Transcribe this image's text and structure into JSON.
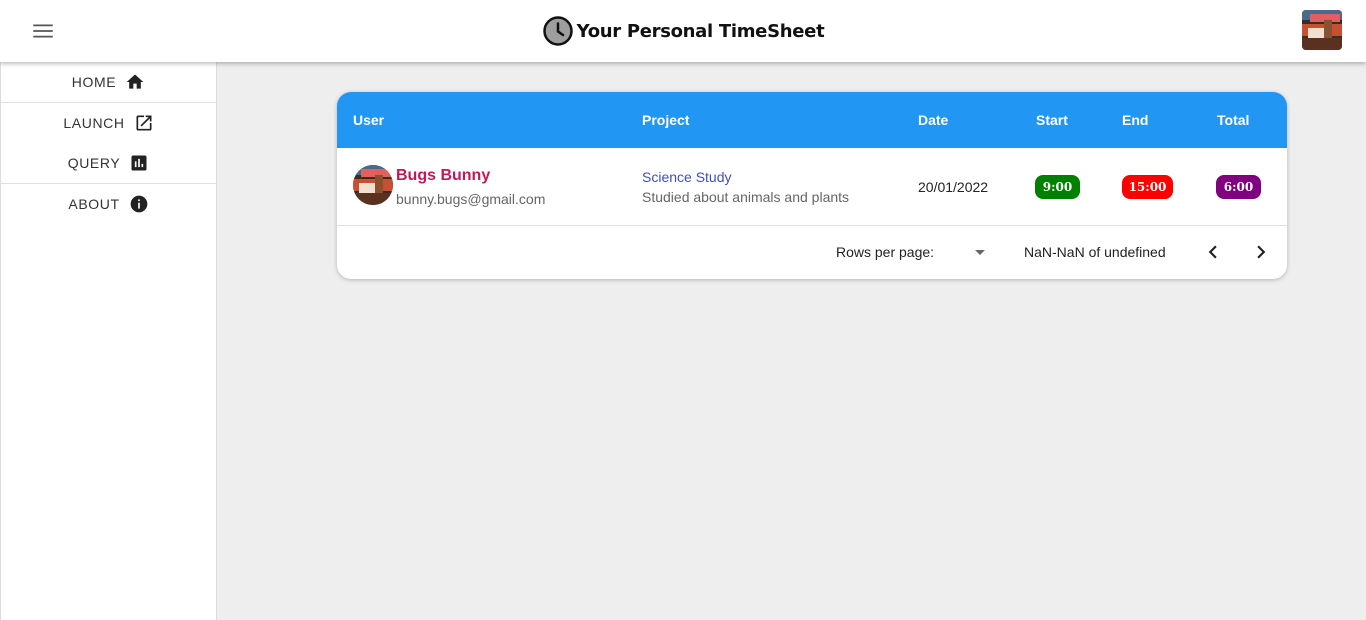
{
  "app": {
    "title": "Your Personal TimeSheet",
    "icons": {
      "menu": "menu-icon",
      "clock": "clock-icon",
      "profile": "profile-avatar"
    }
  },
  "sidebar": {
    "items": [
      {
        "label": "HOME",
        "icon": "home-icon"
      },
      {
        "label": "LAUNCH",
        "icon": "launch-icon"
      },
      {
        "label": "QUERY",
        "icon": "chart-icon"
      },
      {
        "label": "ABOUT",
        "icon": "info-icon"
      }
    ]
  },
  "table": {
    "header_color": "#2196f3",
    "columns": [
      "User",
      "Project",
      "Date",
      "Start",
      "End",
      "Total"
    ],
    "rows": [
      {
        "user_name": "Bugs Bunny",
        "user_email": "bunny.bugs@gmail.com",
        "project_name": "Science Study",
        "project_desc": "Studied about animals and plants",
        "date": "20/01/2022",
        "start": "9:00",
        "end": "15:00",
        "total": "6:00"
      }
    ],
    "badge_colors": {
      "start": "#008000",
      "end": "#ff0000",
      "total": "#800080"
    }
  },
  "pagination": {
    "rows_per_page_label": "Rows per page:",
    "rows_per_page_value": "",
    "range_text": "NaN-NaN of undefined"
  }
}
